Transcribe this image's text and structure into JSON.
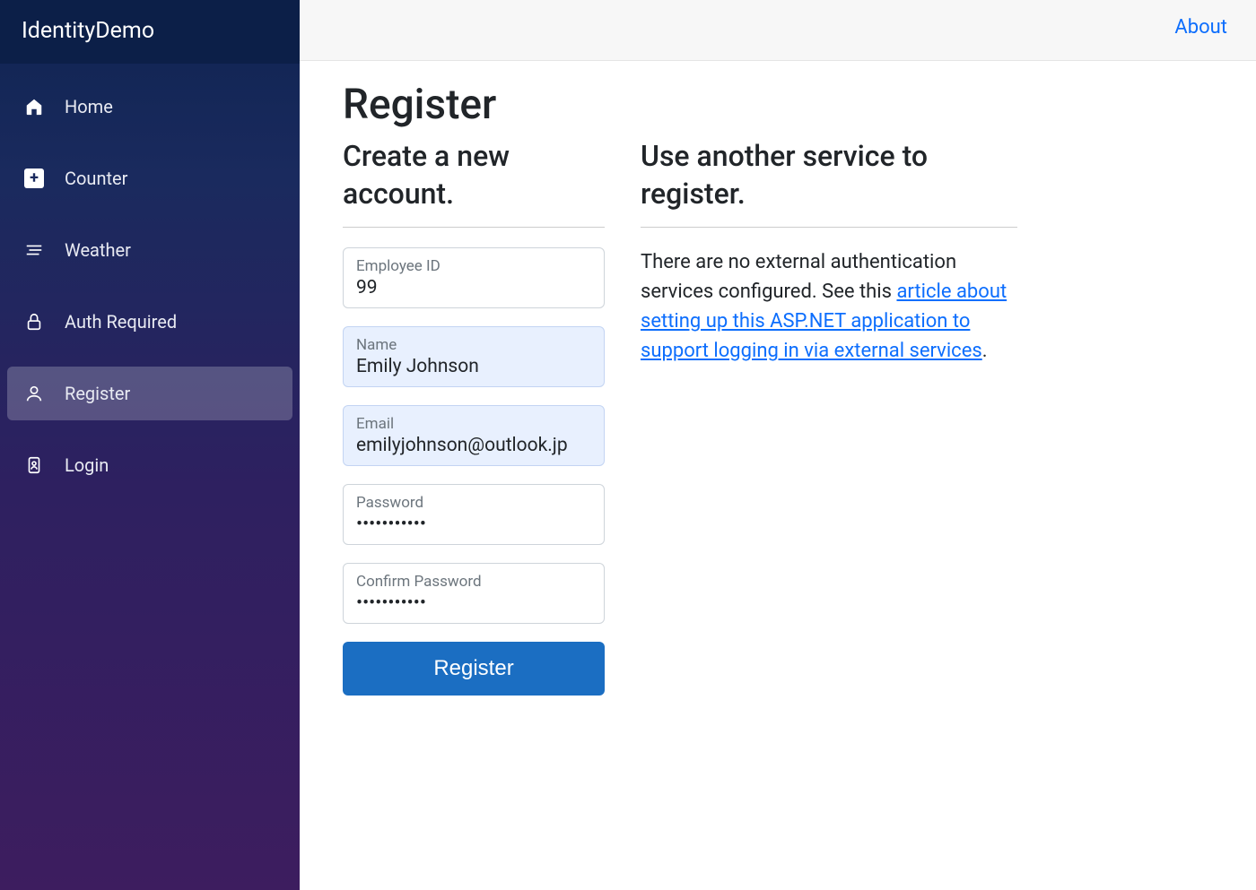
{
  "brand": "IdentityDemo",
  "sidebar": {
    "items": [
      {
        "label": "Home"
      },
      {
        "label": "Counter"
      },
      {
        "label": "Weather"
      },
      {
        "label": "Auth Required"
      },
      {
        "label": "Register"
      },
      {
        "label": "Login"
      }
    ]
  },
  "topbar": {
    "about": "About"
  },
  "page": {
    "title": "Register",
    "create_heading": "Create a new account.",
    "external_heading": "Use another service to register."
  },
  "form": {
    "employee_id": {
      "label": "Employee ID",
      "value": "99"
    },
    "name": {
      "label": "Name",
      "value": "Emily Johnson"
    },
    "email": {
      "label": "Email",
      "value": "emilyjohnson@outlook.jp"
    },
    "password": {
      "label": "Password",
      "value": "•••••••••••"
    },
    "confirm": {
      "label": "Confirm Password",
      "value": "•••••••••••"
    },
    "submit": "Register"
  },
  "external": {
    "prefix": "There are no external authentication services configured. See this ",
    "link": "article about setting up this ASP.NET application to support logging in via external services",
    "suffix": "."
  }
}
